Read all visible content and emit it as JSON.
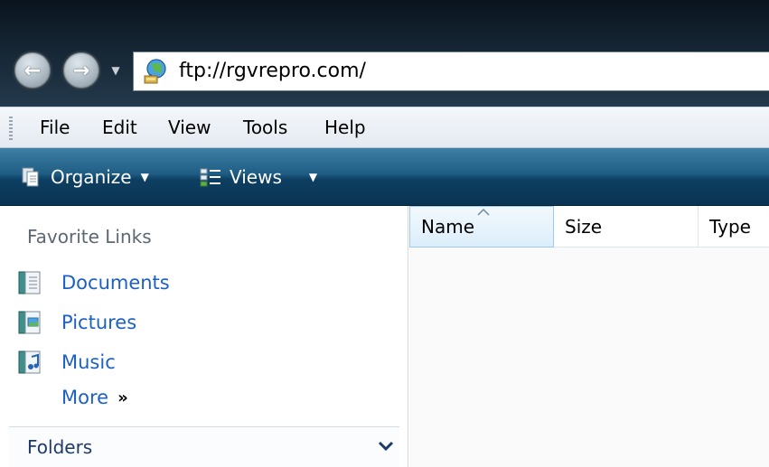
{
  "address_bar": {
    "url": "ftp://rgvrepro.com/",
    "site_icon": "network-globe-icon"
  },
  "navigation": {
    "back_icon": "back-arrow-icon",
    "forward_icon": "forward-arrow-icon",
    "history_icon": "chevron-down-icon"
  },
  "menubar": {
    "items": [
      "File",
      "Edit",
      "View",
      "Tools",
      "Help"
    ]
  },
  "commandbar": {
    "organize_label": "Organize",
    "views_label": "Views"
  },
  "navpane": {
    "heading": "Favorite Links",
    "links": [
      {
        "label": "Documents",
        "icon": "documents-icon"
      },
      {
        "label": "Pictures",
        "icon": "pictures-icon"
      },
      {
        "label": "Music",
        "icon": "music-icon"
      }
    ],
    "more_label": "More",
    "more_glyph": "»",
    "folders_label": "Folders"
  },
  "content": {
    "columns": [
      "Name",
      "Size",
      "Type"
    ],
    "sorted_column": "Name"
  },
  "colors": {
    "link": "#1c60c4",
    "command_bar": "#1f5d84",
    "titlebar": "#13222f"
  }
}
